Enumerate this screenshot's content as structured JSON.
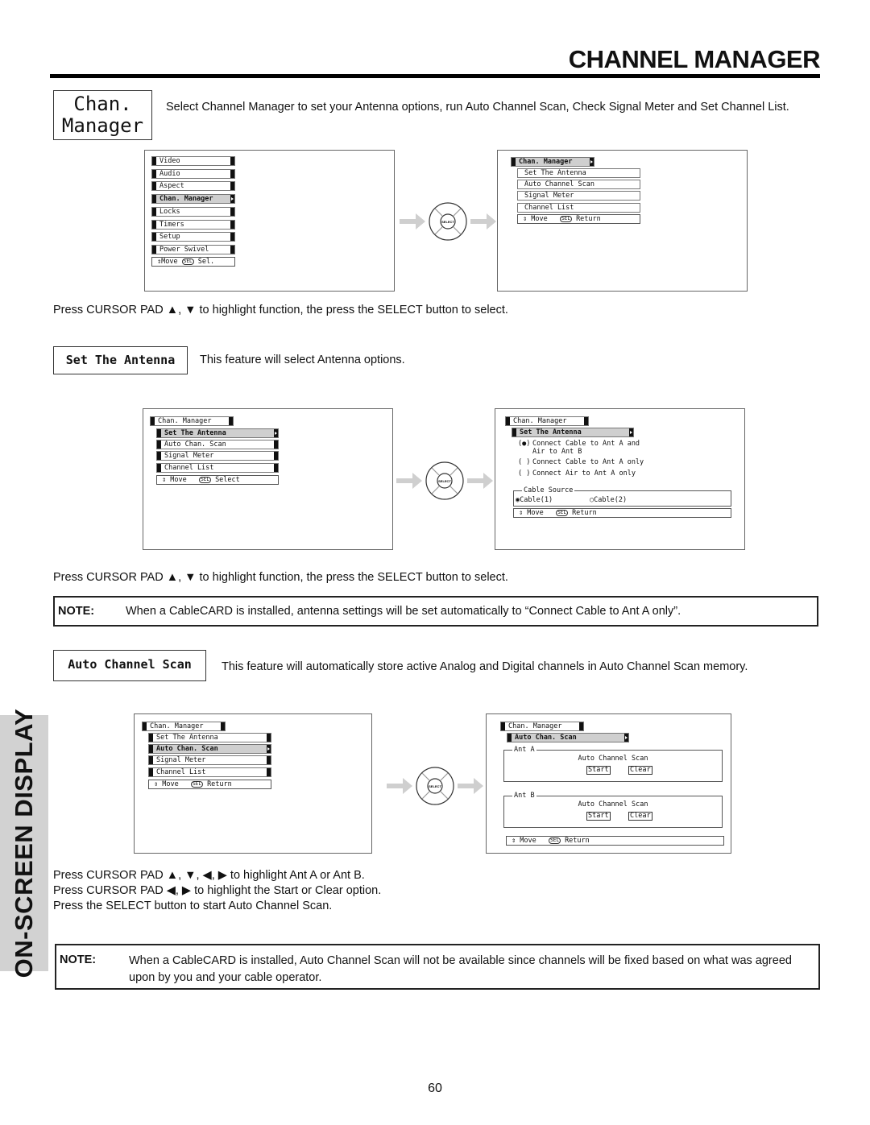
{
  "page": {
    "title": "CHANNEL MANAGER",
    "page_number": "60",
    "side_tab": "ON-SCREEN DISPLAY"
  },
  "intro": {
    "label_line1": "Chan.",
    "label_line2": "Manager",
    "text": "Select Channel Manager to set your Antenna options, run Auto Channel Scan, Check Signal Meter and Set Channel List."
  },
  "remote": {
    "select_label": "SELECT"
  },
  "screen1": {
    "items": [
      "Video",
      "Audio",
      "Aspect",
      "Chan. Manager",
      "Locks",
      "Timers",
      "Setup",
      "Power Swivel"
    ],
    "selected_index": 3,
    "footer_move": "Move",
    "footer_sel_badge": "SEL",
    "footer_action": "Sel."
  },
  "screen2": {
    "header": "Chan. Manager",
    "items": [
      "Set The Antenna",
      "Auto Channel Scan",
      "Signal Meter",
      "Channel List"
    ],
    "footer_move": "Move",
    "footer_sel_badge": "SEL",
    "footer_action": "Return"
  },
  "instruction1": "Press CURSOR PAD ▲, ▼ to highlight function, the press the SELECT button to select.",
  "antenna": {
    "label": "Set The Antenna",
    "text": "This feature will select Antenna options."
  },
  "screen3": {
    "header": "Chan. Manager",
    "items": [
      "Set The Antenna",
      "Auto Chan. Scan",
      "Signal Meter",
      "Channel List"
    ],
    "selected_index": 0,
    "footer_move": "Move",
    "footer_sel_badge": "SEL",
    "footer_action": "Select"
  },
  "screen4": {
    "header": "Chan. Manager",
    "sub_header": "Set The Antenna",
    "options": [
      {
        "mark": "(●)",
        "line1": "Connect Cable to Ant A and",
        "line2": "Air to Ant B"
      },
      {
        "mark": "( )",
        "line1": "Connect Cable to Ant A only",
        "line2": ""
      },
      {
        "mark": "( )",
        "line1": "Connect Air to Ant A only",
        "line2": ""
      }
    ],
    "cable_source_legend": "Cable Source",
    "cable1": "Cable(1)",
    "cable2": "Cable(2)",
    "cable1_mark": "◉",
    "cable2_mark": "○",
    "footer_move": "Move",
    "footer_sel_badge": "SEL",
    "footer_action": "Return"
  },
  "instruction2": "Press CURSOR PAD ▲, ▼ to highlight function, the press the SELECT button to select.",
  "note1": {
    "label": "NOTE:",
    "text": "When a CableCARD is installed, antenna settings will be set automatically to “Connect Cable to Ant A only”."
  },
  "autoscan": {
    "label": "Auto Channel Scan",
    "text": "This feature will automatically store active Analog and Digital channels in Auto Channel Scan memory."
  },
  "screen5": {
    "header": "Chan. Manager",
    "items": [
      "Set The Antenna",
      "Auto Chan. Scan",
      "Signal Meter",
      "Channel List"
    ],
    "selected_index": 1,
    "footer_move": "Move",
    "footer_sel_badge": "SEL",
    "footer_action": "Return"
  },
  "screen6": {
    "header": "Chan. Manager",
    "sub_header": "Auto Chan. Scan",
    "groups": [
      {
        "legend": "Ant A",
        "title": "Auto Channel Scan",
        "start": "Start",
        "clear": "Clear"
      },
      {
        "legend": "Ant B",
        "title": "Auto Channel Scan",
        "start": "Start",
        "clear": "Clear"
      }
    ],
    "footer_move": "Move",
    "footer_sel_badge": "SEL",
    "footer_action": "Return"
  },
  "instructions3": [
    "Press CURSOR PAD ▲, ▼, ◀, ▶ to highlight Ant A or Ant B.",
    "Press CURSOR PAD ◀, ▶ to highlight the Start or Clear option.",
    "Press the SELECT button to start Auto Channel Scan."
  ],
  "note2": {
    "label": "NOTE:",
    "text": "When a CableCARD is installed, Auto Channel Scan will not be available since channels will be fixed based on what was agreed upon by you and your cable operator."
  }
}
